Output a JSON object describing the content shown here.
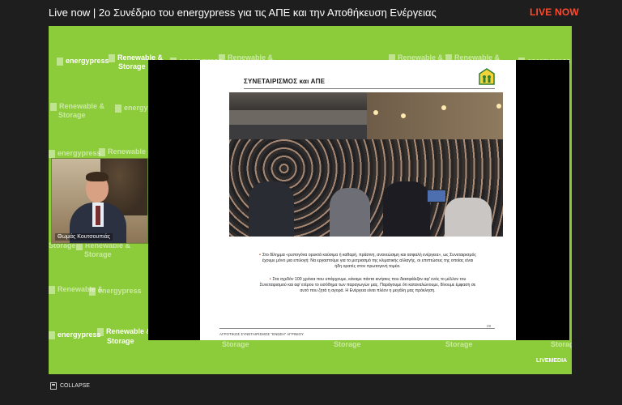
{
  "header": {
    "title": "Live now | 2ο Συνέδριο του energypress για τις ΑΠΕ και την Αποθήκευση Ενέργειας",
    "live_badge": "LIVE NOW"
  },
  "background_logos": {
    "energypress": "energypress",
    "renewable": "Renewable &",
    "storage": "Storage"
  },
  "speaker": {
    "name": "Θωμάς Κουτσουπιάς"
  },
  "slide": {
    "title": "ΣΥΝΕΤΑΙΡΙΣΜΟΣ και ΑΠΕ",
    "bullet1": "Στο δίλημμα «ρυπογόνα ορυκτά καύσιμα ή καθαρή, πράσινη, ανανεώσιμη και ασφαλή ενέργεια», ως Συνεταιρισμός έχουμε μόνο μια επιλογή: Να εργαστούμε για το μετριασμό της κλιματικής αλλαγής, οι επιπτώσεις της οποίας είναι ήδη ορατές στον πρωτογενή τομέα.",
    "bullet2": "Στα σχεδόν 100 χρόνια που υπάρχουμε, κάναμε πάντα κινήσεις που διασφάλιζαν αφ' ενός το μέλλον του Συνεταιρισμού και αφ' ετέρου το εισόδημα των παραγωγών μας. Παράγουμε ότι καταναλώνουμε, δίνουμε έμφαση σε αυτό που ζητά η αγορά. Η Ενέργεια είναι πλέον η μεγάλη μας πρόκληση.",
    "footer": "ΑΓΡΟΤΙΚΟΣ ΣΥΝΕΤΑΙΡΙΣΜΟΣ \"ΕΝΩΣΗ\" ΑΓΡΙΝΙΟΥ",
    "page_number": "29"
  },
  "branding": {
    "provider": "LIVEMEDIA"
  },
  "controls": {
    "collapse_label": "COLLAPSE"
  }
}
